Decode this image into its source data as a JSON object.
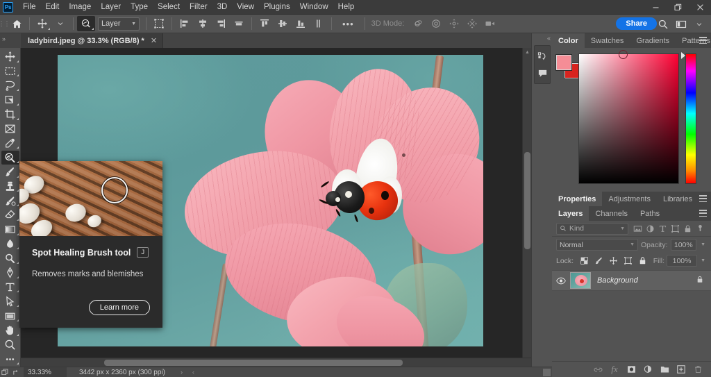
{
  "app": {
    "logo": "Ps",
    "menus": [
      "File",
      "Edit",
      "Image",
      "Layer",
      "Type",
      "Select",
      "Filter",
      "3D",
      "View",
      "Plugins",
      "Window",
      "Help"
    ],
    "window_controls": {
      "minimize": "—",
      "maximize": "❐",
      "close": "✕"
    }
  },
  "options_bar": {
    "home_icon": "home-icon",
    "tool_icon": "move-tool-icon",
    "spot_healing_icon": "spot-healing-brush-icon",
    "target_select": "Layer",
    "auto_select_icon": "transform-controls-icon",
    "align_icons": [
      "align-left-edges",
      "align-horizontal-centers",
      "align-right-edges",
      "align-top-edges"
    ],
    "distribute_icons": [
      "align-top",
      "align-vertical-centers",
      "align-bottom",
      "distribute-vertical"
    ],
    "more_label": "•••",
    "three_d_label": "3D Mode:",
    "three_d_icons": [
      "orbit-3d",
      "roll-3d",
      "pan-3d",
      "slide-3d",
      "scale-3d"
    ],
    "share_label": "Share",
    "search_icon": "search-icon",
    "workspace_icon": "workspace-icon",
    "workspace_caret": "⌄"
  },
  "document_tab": {
    "collapse": "»",
    "title": "ladybird.jpeg @ 33.3% (RGB/8) *",
    "close": "✕"
  },
  "toolbar": {
    "tools": [
      {
        "name": "move-tool",
        "label": "Move tool",
        "has_flyout": true,
        "active": false
      },
      {
        "name": "rectangular-marquee-tool",
        "label": "Rectangular Marquee tool",
        "has_flyout": true,
        "active": false
      },
      {
        "name": "lasso-tool",
        "label": "Lasso tool",
        "has_flyout": true,
        "active": false
      },
      {
        "name": "object-selection-tool",
        "label": "Object Selection tool",
        "has_flyout": true,
        "active": false
      },
      {
        "name": "crop-tool",
        "label": "Crop tool",
        "has_flyout": true,
        "active": false
      },
      {
        "name": "frame-tool",
        "label": "Frame tool",
        "has_flyout": false,
        "active": false
      },
      {
        "name": "eyedropper-tool",
        "label": "Eyedropper tool",
        "has_flyout": true,
        "active": false
      },
      {
        "name": "spot-healing-brush-tool",
        "label": "Spot Healing Brush tool",
        "has_flyout": true,
        "active": true
      },
      {
        "name": "brush-tool",
        "label": "Brush tool",
        "has_flyout": true,
        "active": false
      },
      {
        "name": "clone-stamp-tool",
        "label": "Clone Stamp tool",
        "has_flyout": true,
        "active": false
      },
      {
        "name": "history-brush-tool",
        "label": "History Brush tool",
        "has_flyout": true,
        "active": false
      },
      {
        "name": "eraser-tool",
        "label": "Eraser tool",
        "has_flyout": true,
        "active": false
      },
      {
        "name": "gradient-tool",
        "label": "Gradient tool",
        "has_flyout": true,
        "active": false
      },
      {
        "name": "blur-tool",
        "label": "Blur tool",
        "has_flyout": true,
        "active": false
      },
      {
        "name": "dodge-tool",
        "label": "Dodge tool",
        "has_flyout": true,
        "active": false
      },
      {
        "name": "pen-tool",
        "label": "Pen tool",
        "has_flyout": true,
        "active": false
      },
      {
        "name": "type-tool",
        "label": "Horizontal Type tool",
        "has_flyout": true,
        "active": false
      },
      {
        "name": "path-selection-tool",
        "label": "Path Selection tool",
        "has_flyout": true,
        "active": false
      },
      {
        "name": "rectangle-tool",
        "label": "Rectangle tool",
        "has_flyout": true,
        "active": false
      },
      {
        "name": "hand-tool",
        "label": "Hand tool",
        "has_flyout": true,
        "active": false
      },
      {
        "name": "zoom-tool",
        "label": "Zoom tool",
        "has_flyout": false,
        "active": false
      },
      {
        "name": "edit-toolbar",
        "label": "Edit Toolbar",
        "has_flyout": true,
        "active": false
      }
    ]
  },
  "tooltip": {
    "title": "Spot Healing Brush tool",
    "shortcut": "J",
    "description": "Removes marks and blemishes",
    "learn_more": "Learn more"
  },
  "narrow_dock": {
    "collapse": "«",
    "icons": [
      {
        "name": "history-icon",
        "label": "History"
      },
      {
        "name": "comments-icon",
        "label": "Comments"
      }
    ]
  },
  "color_panel": {
    "tabs": [
      {
        "label": "Color",
        "active": true
      },
      {
        "label": "Swatches",
        "active": false
      },
      {
        "label": "Gradients",
        "active": false
      },
      {
        "label": "Patterns",
        "active": false
      }
    ],
    "foreground_color": "#F58D96",
    "background_color": "#D8241F",
    "menu_icon": "panel-menu-icon"
  },
  "properties_panel": {
    "tabs": [
      {
        "label": "Properties",
        "active": true
      },
      {
        "label": "Adjustments",
        "active": false
      },
      {
        "label": "Libraries",
        "active": false
      }
    ],
    "menu_icon": "panel-menu-icon"
  },
  "layers_panel": {
    "tabs": [
      {
        "label": "Layers",
        "active": true
      },
      {
        "label": "Channels",
        "active": false
      },
      {
        "label": "Paths",
        "active": false
      }
    ],
    "menu_icon": "panel-menu-icon",
    "filter": {
      "kind_label": "Kind",
      "search_icon": "search-icon",
      "caret": "⌄",
      "type_filters": [
        {
          "name": "filter-pixel-layers-icon"
        },
        {
          "name": "filter-adjustment-layers-icon"
        },
        {
          "name": "filter-type-layers-icon"
        },
        {
          "name": "filter-shape-layers-icon"
        },
        {
          "name": "filter-smart-object-icon"
        },
        {
          "name": "filter-toggle-icon"
        }
      ]
    },
    "blend_mode": "Normal",
    "opacity_label": "Opacity:",
    "opacity_value": "100%",
    "lock_label": "Lock:",
    "lock_icons": [
      {
        "name": "lock-transparent-pixels-icon"
      },
      {
        "name": "lock-image-pixels-icon"
      },
      {
        "name": "lock-position-icon"
      },
      {
        "name": "lock-artboard-nesting-icon"
      },
      {
        "name": "lock-all-icon"
      }
    ],
    "fill_label": "Fill:",
    "fill_value": "100%",
    "layers": [
      {
        "name": "Background",
        "visible": true,
        "locked": true
      }
    ],
    "footer_icons": [
      {
        "name": "link-layers-icon",
        "dim": true
      },
      {
        "name": "layer-style-fx-icon",
        "dim": true
      },
      {
        "name": "add-layer-mask-icon",
        "dim": false
      },
      {
        "name": "new-adjustment-layer-icon",
        "dim": false
      },
      {
        "name": "new-group-icon",
        "dim": false
      },
      {
        "name": "new-layer-icon",
        "dim": false
      },
      {
        "name": "delete-layer-icon",
        "dim": true
      }
    ]
  },
  "status_bar": {
    "zoom": "33.33%",
    "dimensions": "3442 px x 2360 px (300 ppi)",
    "arrow": "›",
    "arrow2": "‹"
  },
  "canvas": {
    "document_name": "ladybird.jpeg",
    "subject": "ladybird beetle on pink flower"
  }
}
